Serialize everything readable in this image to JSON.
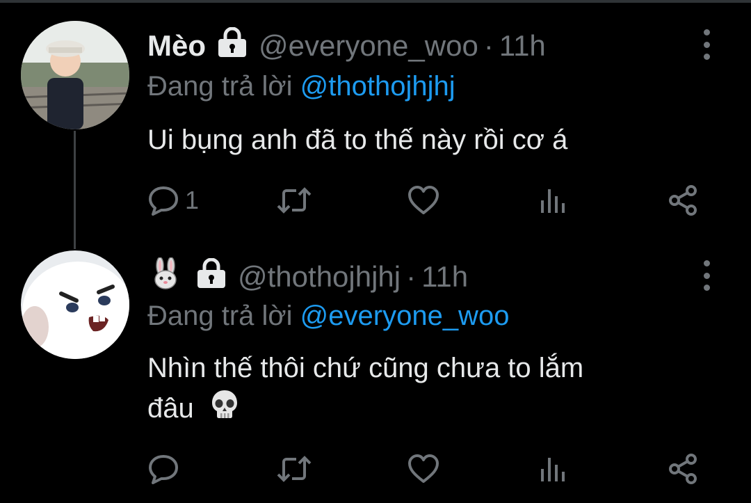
{
  "tweets": [
    {
      "name": "Mèo",
      "handle": "@everyone_woo",
      "separator": "·",
      "time": "11h",
      "reply_prefix": "Đang trả lời ",
      "reply_to": "@thothojhjhj",
      "text": "Ui bụng anh đã to thế này rồi cơ á",
      "reply_count": "1",
      "avatar_desc": "boy-in-cap"
    },
    {
      "name_emoji": "rabbit-emoji",
      "handle": "@thothojhjhj",
      "separator": "·",
      "time": "11h",
      "reply_prefix": "Đang trả lời ",
      "reply_to": "@everyone_woo",
      "text_line1": "Nhìn thế thôi chứ cũng chưa to lắm",
      "text_line2": "đâu",
      "text_emoji": "skull-emoji",
      "reply_count": "",
      "avatar_desc": "angry-white-rabbit"
    }
  ],
  "colors": {
    "background": "#000000",
    "text": "#e7e9ea",
    "muted": "#71767b",
    "link": "#1d9bf0"
  },
  "icons": [
    "lock-icon",
    "more-icon",
    "reply-icon",
    "retweet-icon",
    "like-icon",
    "views-icon",
    "share-icon"
  ]
}
